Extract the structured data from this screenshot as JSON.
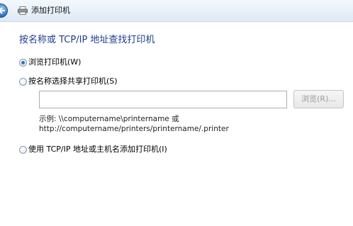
{
  "window": {
    "title": "添加打印机"
  },
  "page": {
    "heading": "按名称或 TCP/IP 地址查找打印机"
  },
  "options": {
    "browse_label": "浏览打印机(W)",
    "by_name_label": "按名称选择共享打印机(S)",
    "tcpip_label": "使用 TCP/IP 地址或主机名添加打印机(I)"
  },
  "share": {
    "input_value": "",
    "browse_button": "浏览(R)...",
    "example_line1": "示例: \\\\computername\\printername 或",
    "example_line2": "http://computername/printers/printername/.printer"
  },
  "colors": {
    "heading": "#1c3d8f",
    "titlebar": "#dfeaf6"
  },
  "icons": {
    "back": "back-arrow-icon",
    "printer": "printer-icon"
  }
}
